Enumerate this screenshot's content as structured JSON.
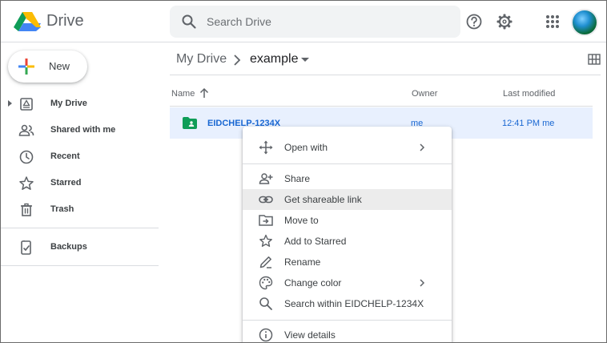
{
  "app": {
    "name": "Drive"
  },
  "search": {
    "placeholder": "Search Drive"
  },
  "header_icons": [
    "help-icon",
    "settings-icon",
    "apps-grid-icon",
    "account-avatar"
  ],
  "new_button": {
    "label": "New"
  },
  "sidebar": {
    "items": [
      {
        "label": "My Drive",
        "icon": "my-drive-icon"
      },
      {
        "label": "Shared with me",
        "icon": "people-icon"
      },
      {
        "label": "Recent",
        "icon": "clock-icon"
      },
      {
        "label": "Starred",
        "icon": "star-icon"
      },
      {
        "label": "Trash",
        "icon": "trash-icon"
      },
      {
        "label": "Backups",
        "icon": "backup-icon"
      }
    ]
  },
  "breadcrumb": {
    "root": "My Drive",
    "current": "example"
  },
  "table": {
    "columns": {
      "name": "Name",
      "owner": "Owner",
      "modified": "Last modified"
    },
    "rows": [
      {
        "name": "EIDCHELP-1234X",
        "owner": "me",
        "modified": "12:41 PM  me"
      }
    ]
  },
  "context_menu": {
    "items": [
      {
        "label": "Open with",
        "icon": "move-arrows-icon",
        "submenu": true
      },
      {
        "label": "Share",
        "icon": "add-person-icon"
      },
      {
        "label": "Get shareable link",
        "icon": "link-icon",
        "highlighted": true
      },
      {
        "label": "Move to",
        "icon": "move-folder-icon"
      },
      {
        "label": "Add to Starred",
        "icon": "star-icon"
      },
      {
        "label": "Rename",
        "icon": "pencil-icon"
      },
      {
        "label": "Change color",
        "icon": "palette-icon",
        "submenu": true
      },
      {
        "label": "Search within EIDCHELP-1234X",
        "icon": "search-icon"
      },
      {
        "label": "View details",
        "icon": "info-icon"
      }
    ]
  },
  "colors": {
    "selection": "#e8f0fe",
    "link_blue": "#1967d2",
    "folder_green": "#0f9d58"
  }
}
